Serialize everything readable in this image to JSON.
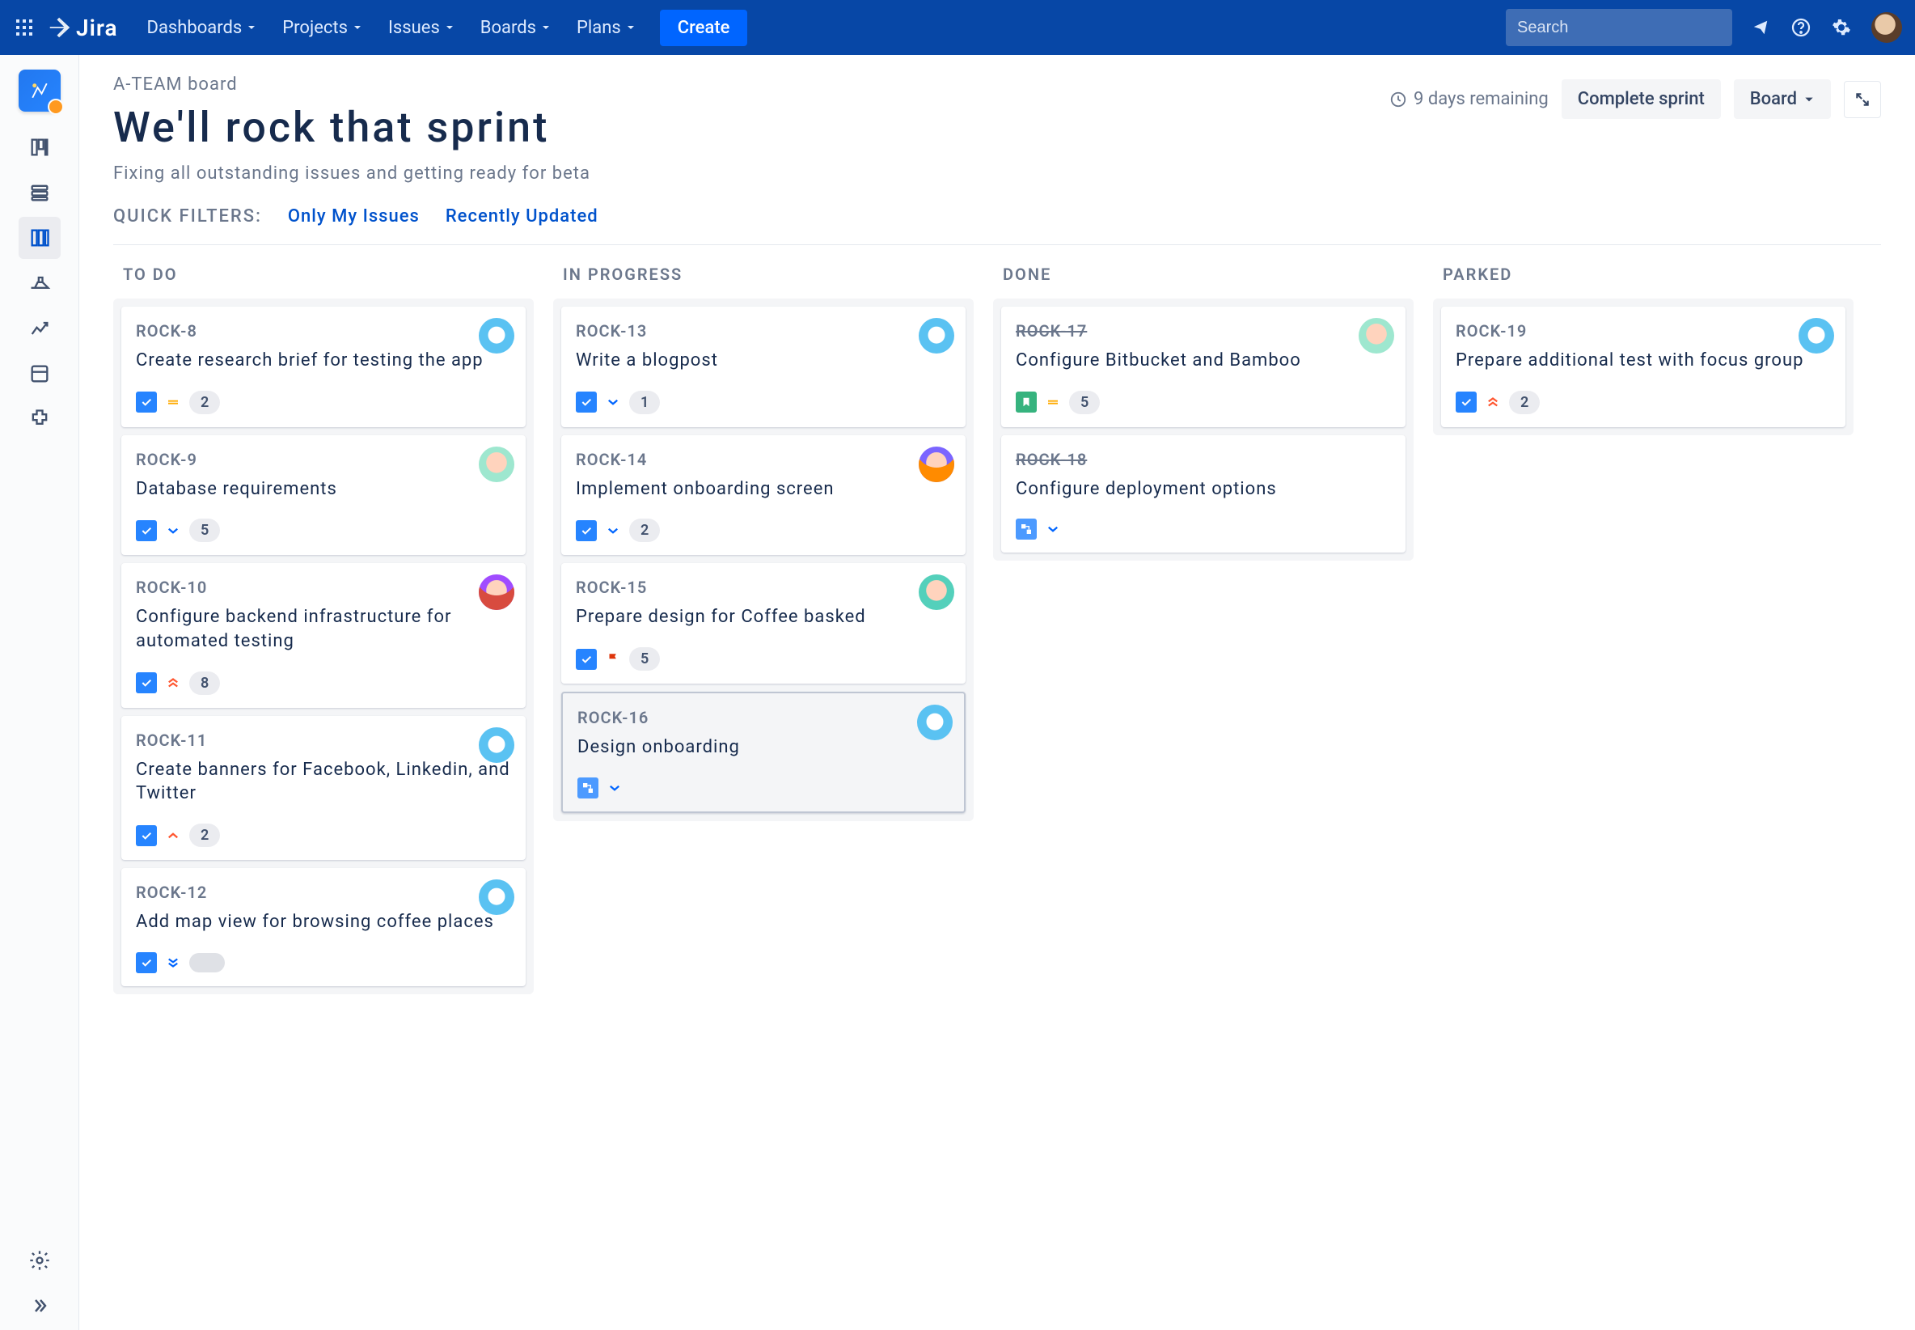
{
  "topnav": {
    "brand": "Jira",
    "links": [
      "Dashboards",
      "Projects",
      "Issues",
      "Boards",
      "Plans"
    ],
    "create": "Create",
    "searchPlaceholder": "Search"
  },
  "header": {
    "breadcrumb": "A-TEAM board",
    "title": "We'll rock that sprint",
    "subtitle": "Fixing all outstanding issues and getting ready for beta",
    "daysRemaining": "9 days remaining",
    "completeSprint": "Complete sprint",
    "viewLabel": "Board",
    "filtersLabel": "QUICK FILTERS:",
    "filters": [
      "Only My Issues",
      "Recently Updated"
    ]
  },
  "columns": [
    {
      "name": "TO DO",
      "cards": [
        {
          "key": "ROCK-8",
          "title": "Create research brief for testing the app",
          "type": "task",
          "priority": "medium",
          "points": "2",
          "avatar": "blue"
        },
        {
          "key": "ROCK-9",
          "title": "Database requirements",
          "type": "task",
          "priority": "low",
          "points": "5",
          "avatar": "peach"
        },
        {
          "key": "ROCK-10",
          "title": "Configure backend infrastructure for automated testing",
          "type": "task",
          "priority": "highest",
          "points": "8",
          "avatar": "red"
        },
        {
          "key": "ROCK-11",
          "title": "Create banners for Facebook, Linkedin, and Twitter",
          "type": "task",
          "priority": "high",
          "points": "2",
          "avatar": "blue"
        },
        {
          "key": "ROCK-12",
          "title": "Add map view for browsing coffee places",
          "type": "task",
          "priority": "lowest",
          "avatar": "blue",
          "extra": "toggle"
        }
      ]
    },
    {
      "name": "IN PROGRESS",
      "cards": [
        {
          "key": "ROCK-13",
          "title": "Write a blogpost",
          "type": "task",
          "priority": "low",
          "points": "1",
          "avatar": "blue"
        },
        {
          "key": "ROCK-14",
          "title": "Implement onboarding screen",
          "type": "task",
          "priority": "low",
          "points": "2",
          "avatar": "orange"
        },
        {
          "key": "ROCK-15",
          "title": "Prepare design for Coffee basked",
          "type": "task",
          "priority": "flag",
          "points": "5",
          "avatar": "pink"
        },
        {
          "key": "ROCK-16",
          "title": "Design onboarding",
          "type": "sub",
          "priority": "low",
          "avatar": "blue",
          "selected": true
        }
      ]
    },
    {
      "name": "DONE",
      "cards": [
        {
          "key": "ROCK-17",
          "title": "Configure Bitbucket and Bamboo",
          "type": "story",
          "priority": "medium",
          "points": "5",
          "avatar": "peach",
          "done": true
        },
        {
          "key": "ROCK-18",
          "title": "Configure deployment options",
          "type": "sub",
          "priority": "low",
          "done": true
        }
      ]
    },
    {
      "name": "PARKED",
      "cards": [
        {
          "key": "ROCK-19",
          "title": "Prepare additional test with focus group",
          "type": "task",
          "priority": "highest",
          "points": "2",
          "avatar": "blue"
        }
      ]
    }
  ]
}
